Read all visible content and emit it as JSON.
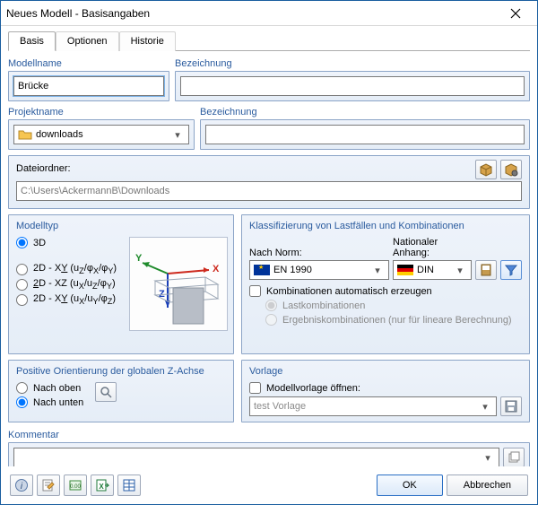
{
  "window": {
    "title": "Neues Modell - Basisangaben"
  },
  "tabs": {
    "basis": "Basis",
    "optionen": "Optionen",
    "historie": "Historie"
  },
  "modellname": {
    "label": "Modellname",
    "value": "Brücke"
  },
  "bezeichnung_model": {
    "label": "Bezeichnung",
    "value": ""
  },
  "projektname": {
    "label": "Projektname",
    "value": "downloads"
  },
  "bezeichnung_projekt": {
    "label": "Bezeichnung",
    "value": ""
  },
  "dateiordner": {
    "label": "Dateiordner:",
    "value": "C:\\Users\\AckermannB\\Downloads"
  },
  "modelltyp": {
    "title": "Modelltyp",
    "r3d": "3D",
    "r2dxy": "2D - XY (uz/φx/φy)",
    "r2dxz": "2D - XZ (ux/uz/φy)",
    "r2dxy2": "2D - XY (ux/uy/φz)"
  },
  "klass": {
    "title": "Klassifizierung von Lastfällen und Kombinationen",
    "nachnorm": "Nach Norm:",
    "anhang": "Nationaler Anhang:",
    "norm_value": "EN 1990",
    "anhang_value": "DIN",
    "kombi": "Kombinationen automatisch erzeugen",
    "lastkombi": "Lastkombinationen",
    "ergebnis": "Ergebniskombinationen (nur für lineare Berechnung)"
  },
  "zachse": {
    "title": "Positive Orientierung der globalen Z-Achse",
    "oben": "Nach oben",
    "unten": "Nach unten"
  },
  "vorlage": {
    "title": "Vorlage",
    "open": "Modellvorlage öffnen:",
    "value": "test Vorlage"
  },
  "kommentar": {
    "title": "Kommentar",
    "value": ""
  },
  "buttons": {
    "ok": "OK",
    "cancel": "Abbrechen"
  }
}
